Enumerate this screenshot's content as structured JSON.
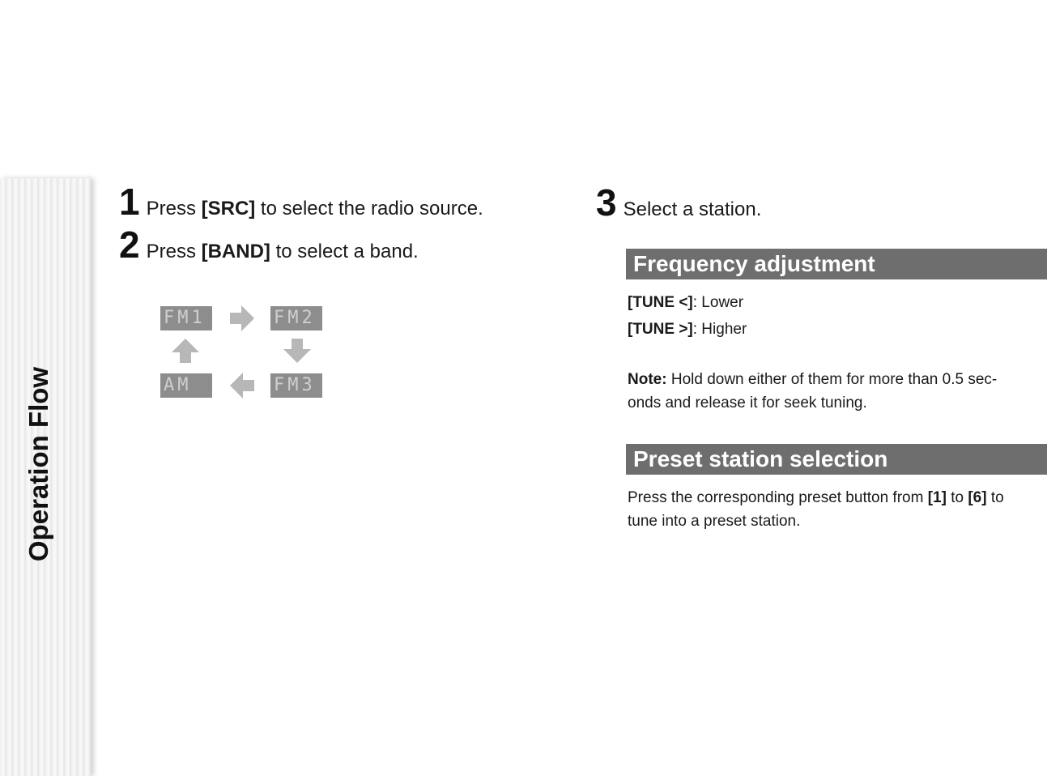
{
  "side_tab": {
    "label": "Operation Flow"
  },
  "steps": [
    {
      "num": "1",
      "pre": "Press ",
      "key": "[SRC]",
      "post": " to select the radio source."
    },
    {
      "num": "2",
      "pre": "Press ",
      "key": "[BAND]",
      "post": " to select a band."
    },
    {
      "num": "3",
      "text": "Select a station."
    }
  ],
  "band_diagram": {
    "displays": [
      "FM1",
      "FM2",
      "AM",
      "FM3"
    ]
  },
  "frequency": {
    "heading": "Frequency adjustment",
    "lower_key": "[TUNE <]",
    "lower_text": ": Lower",
    "higher_key": "[TUNE >]",
    "higher_text": ": Higher",
    "note_label": "Note:",
    "note_line1": " Hold down either of them for more than 0.5 sec-",
    "note_line2": "onds and release it for seek tuning."
  },
  "preset": {
    "heading": "Preset station selection",
    "line1_pre": "Press the corresponding preset button from ",
    "key1": "[1]",
    "mid": " to ",
    "key6": "[6]",
    "line1_post": " to",
    "line2": "tune into a preset station."
  }
}
